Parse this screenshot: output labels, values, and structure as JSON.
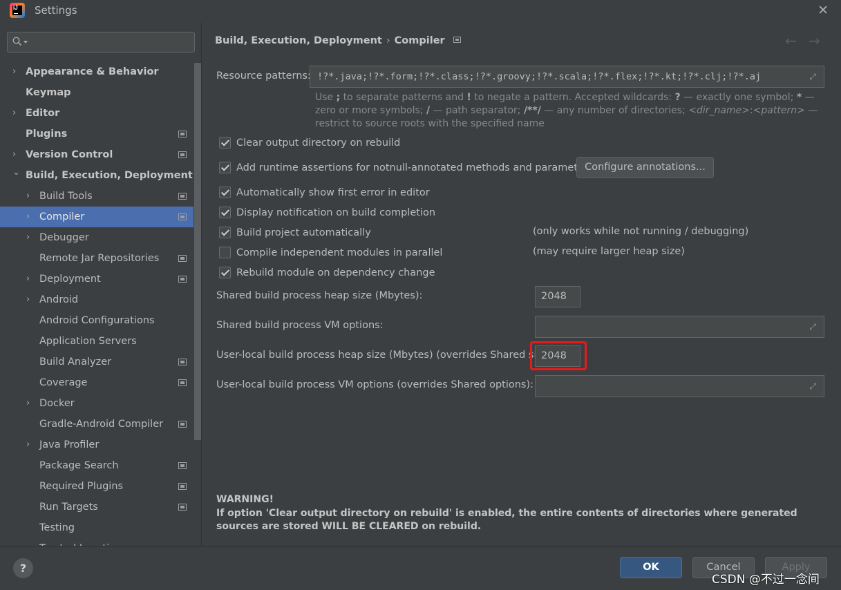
{
  "window": {
    "title": "Settings",
    "close_icon": "close-icon"
  },
  "sidebar": {
    "search": {
      "placeholder": "",
      "value": ""
    },
    "items": [
      {
        "label": "Appearance & Behavior",
        "expandable": true,
        "bold": true,
        "level": 0,
        "config_icon": false
      },
      {
        "label": "Keymap",
        "expandable": false,
        "bold": true,
        "level": 0,
        "config_icon": false
      },
      {
        "label": "Editor",
        "expandable": true,
        "bold": true,
        "level": 0,
        "config_icon": false
      },
      {
        "label": "Plugins",
        "expandable": false,
        "bold": true,
        "level": 0,
        "config_icon": true
      },
      {
        "label": "Version Control",
        "expandable": true,
        "bold": true,
        "level": 0,
        "config_icon": true
      },
      {
        "label": "Build, Execution, Deployment",
        "expandable": true,
        "expanded": true,
        "bold": true,
        "level": 0,
        "config_icon": false
      },
      {
        "label": "Build Tools",
        "expandable": true,
        "bold": false,
        "level": 1,
        "config_icon": true
      },
      {
        "label": "Compiler",
        "expandable": true,
        "bold": false,
        "level": 1,
        "config_icon": true,
        "selected": true
      },
      {
        "label": "Debugger",
        "expandable": true,
        "bold": false,
        "level": 1,
        "config_icon": false
      },
      {
        "label": "Remote Jar Repositories",
        "expandable": false,
        "bold": false,
        "level": 1,
        "config_icon": true
      },
      {
        "label": "Deployment",
        "expandable": true,
        "bold": false,
        "level": 1,
        "config_icon": true
      },
      {
        "label": "Android",
        "expandable": true,
        "bold": false,
        "level": 1,
        "config_icon": false
      },
      {
        "label": "Android Configurations",
        "expandable": false,
        "bold": false,
        "level": 1,
        "config_icon": false
      },
      {
        "label": "Application Servers",
        "expandable": false,
        "bold": false,
        "level": 1,
        "config_icon": false
      },
      {
        "label": "Build Analyzer",
        "expandable": false,
        "bold": false,
        "level": 1,
        "config_icon": true
      },
      {
        "label": "Coverage",
        "expandable": false,
        "bold": false,
        "level": 1,
        "config_icon": true
      },
      {
        "label": "Docker",
        "expandable": true,
        "bold": false,
        "level": 1,
        "config_icon": false
      },
      {
        "label": "Gradle-Android Compiler",
        "expandable": false,
        "bold": false,
        "level": 1,
        "config_icon": true
      },
      {
        "label": "Java Profiler",
        "expandable": true,
        "bold": false,
        "level": 1,
        "config_icon": false
      },
      {
        "label": "Package Search",
        "expandable": false,
        "bold": false,
        "level": 1,
        "config_icon": true
      },
      {
        "label": "Required Plugins",
        "expandable": false,
        "bold": false,
        "level": 1,
        "config_icon": true
      },
      {
        "label": "Run Targets",
        "expandable": false,
        "bold": false,
        "level": 1,
        "config_icon": true
      },
      {
        "label": "Testing",
        "expandable": false,
        "bold": false,
        "level": 1,
        "config_icon": false
      },
      {
        "label": "Trusted Locations",
        "expandable": false,
        "bold": false,
        "level": 1,
        "config_icon": false
      }
    ]
  },
  "breadcrumb": {
    "parent": "Build, Execution, Deployment",
    "separator": "›",
    "current": "Compiler"
  },
  "nav": {
    "back": "←",
    "forward": "→"
  },
  "resource_patterns": {
    "label": "Resource patterns:",
    "value": "!?*.java;!?*.form;!?*.class;!?*.groovy;!?*.scala;!?*.flex;!?*.kt;!?*.clj;!?*.aj",
    "hint_parts": [
      "Use ",
      ";",
      " to separate patterns and ",
      "!",
      " to negate a pattern. Accepted wildcards: ",
      "?",
      " — exactly one symbol; ",
      "*",
      " — zero or more symbols; ",
      "/",
      " — path separator; ",
      "/**/",
      " — any number of directories; ",
      "<dir_name>",
      ":",
      "<pattern>",
      " — restrict to source roots with the specified name"
    ]
  },
  "checkboxes": [
    {
      "label": "Clear output directory on rebuild",
      "checked": true,
      "note": ""
    },
    {
      "label": "Add runtime assertions for notnull-annotated methods and parameters",
      "checked": true,
      "note": ""
    },
    {
      "label": "Automatically show first error in editor",
      "checked": true,
      "note": ""
    },
    {
      "label": "Display notification on build completion",
      "checked": true,
      "note": ""
    },
    {
      "label": "Build project automatically",
      "checked": true,
      "note": "(only works while not running / debugging)"
    },
    {
      "label": "Compile independent modules in parallel",
      "checked": false,
      "note": "(may require larger heap size)"
    },
    {
      "label": "Rebuild module on dependency change",
      "checked": true,
      "note": ""
    }
  ],
  "configure_annotations_button": "Configure annotations...",
  "shared_heap": {
    "label": "Shared build process heap size (Mbytes):",
    "value": "2048"
  },
  "shared_vm": {
    "label": "Shared build process VM options:",
    "value": ""
  },
  "user_heap": {
    "label": "User-local build process heap size (Mbytes) (overrides Shared size):",
    "value": "2048"
  },
  "user_vm": {
    "label": "User-local build process VM options (overrides Shared options):",
    "value": ""
  },
  "warning": {
    "title": "WARNING!",
    "body": "If option 'Clear output directory on rebuild' is enabled, the entire contents of directories where generated sources are stored WILL BE CLEARED on rebuild."
  },
  "footer": {
    "help": "?",
    "ok": "OK",
    "cancel": "Cancel",
    "apply": "Apply"
  },
  "watermark": "CSDN @不过一念间",
  "colors": {
    "selection": "#4b6eaf",
    "highlight_box": "#e81b1b",
    "ok_button": "#365880",
    "background": "#3c3f41"
  }
}
